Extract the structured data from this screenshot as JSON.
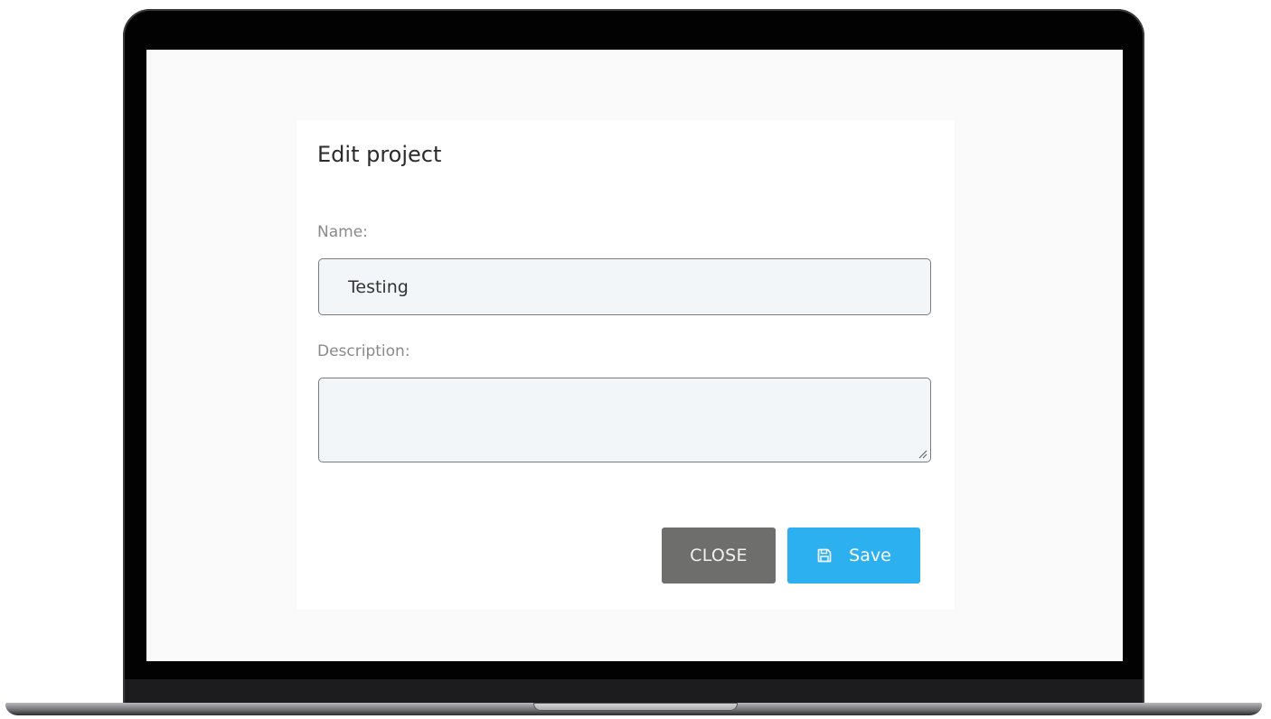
{
  "modal": {
    "title": "Edit project",
    "name_label": "Name:",
    "name_value": "Testing",
    "description_label": "Description:",
    "description_value": "",
    "close_label": "CLOSE",
    "save_label": "Save"
  },
  "icons": {
    "save": "floppy-disk-icon",
    "resize": "resize-grip-icon"
  },
  "colors": {
    "save_button": "#2db0f0",
    "close_button": "#6e6e6c",
    "input_background": "#f3f6f9",
    "screen_background": "#fafafa"
  }
}
